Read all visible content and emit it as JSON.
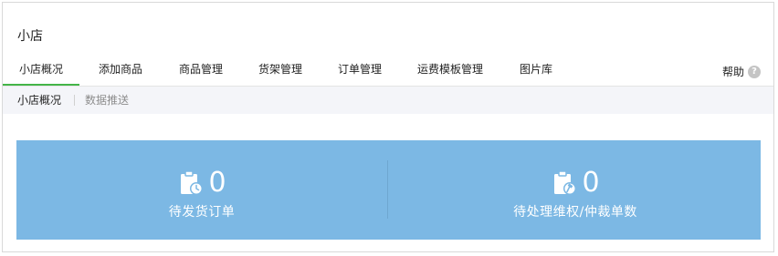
{
  "app": {
    "title": "小店"
  },
  "main_tabs": [
    {
      "label": "小店概况",
      "active": true
    },
    {
      "label": "添加商品",
      "active": false
    },
    {
      "label": "商品管理",
      "active": false
    },
    {
      "label": "货架管理",
      "active": false
    },
    {
      "label": "订单管理",
      "active": false
    },
    {
      "label": "运费模板管理",
      "active": false
    },
    {
      "label": "图片库",
      "active": false
    }
  ],
  "help": {
    "label": "帮助",
    "icon": "question-icon"
  },
  "sub_tabs": [
    {
      "label": "小店概况",
      "active": true
    },
    {
      "label": "数据推送",
      "active": false
    }
  ],
  "stats": [
    {
      "count": "0",
      "label": "待发货订单",
      "icon": "clipboard-clock-icon"
    },
    {
      "count": "0",
      "label": "待处理维权/仲裁单数",
      "icon": "clipboard-gavel-icon"
    }
  ],
  "colors": {
    "accent_green": "#44b549",
    "panel_blue": "#7cb8e4",
    "subnav_bg": "#f4f5f9"
  }
}
